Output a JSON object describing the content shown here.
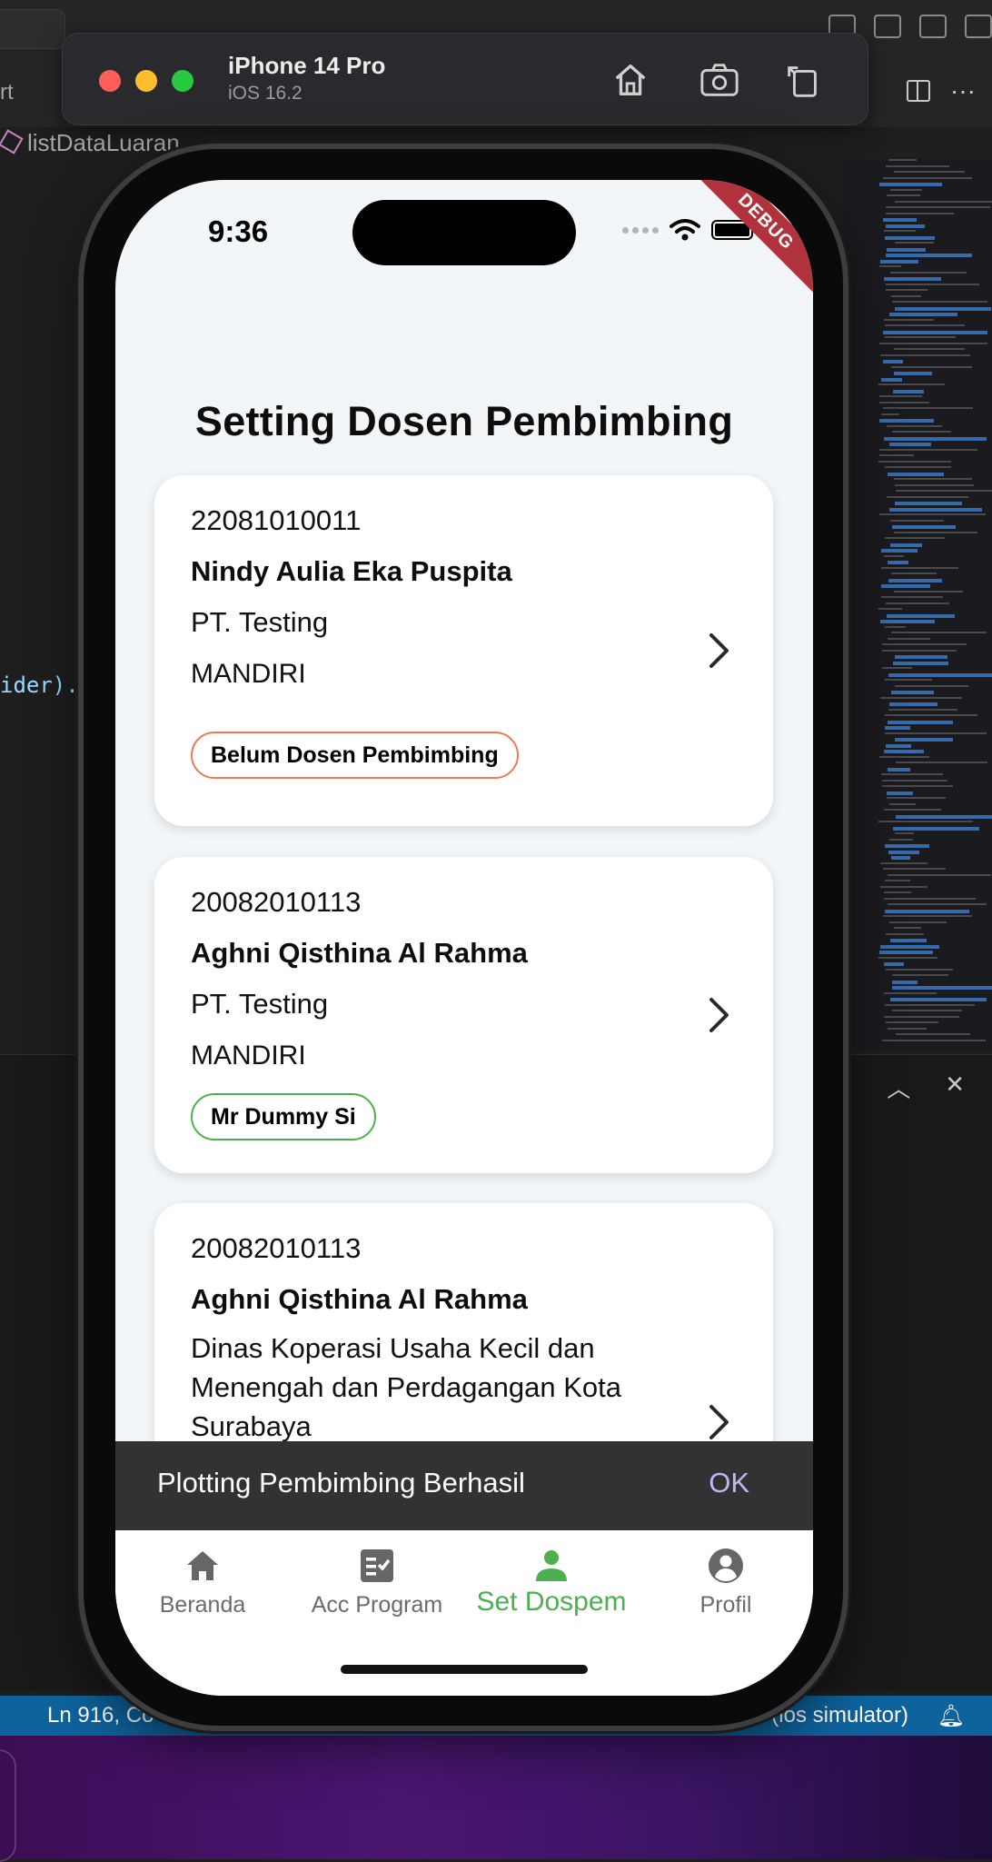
{
  "ide": {
    "tab_fragment": "rt",
    "breadcrumb": "listDataLuaran",
    "code_fragment": "ider).",
    "status_line": "Ln 916, Co",
    "status_target": "(ios simulator)"
  },
  "simulator": {
    "device_name": "iPhone 14 Pro",
    "os_version": "iOS 16.2"
  },
  "phone": {
    "time": "9:36",
    "debug_label": "DEBUG"
  },
  "page": {
    "title": "Setting Dosen Pembimbing"
  },
  "cards": [
    {
      "id": "22081010011",
      "name": "Nindy Aulia Eka Puspita",
      "company": "PT. Testing",
      "program": "MANDIRI",
      "chip": "Belum Dosen Pembimbing",
      "chip_color": "#ee7a55"
    },
    {
      "id": "20082010113",
      "name": "Aghni Qisthina Al Rahma",
      "company": "PT. Testing",
      "program": "MANDIRI",
      "chip": "Mr Dummy Si",
      "chip_color": "#4caf50"
    },
    {
      "id": "20082010113",
      "name": "Aghni Qisthina Al Rahma",
      "company": "Dinas Koperasi Usaha Kecil dan Menengah dan Perdagangan Kota Surabaya"
    }
  ],
  "snackbar": {
    "message": "Plotting Pembimbing Berhasil",
    "action": "OK"
  },
  "bottom_nav": {
    "items": [
      {
        "label": "Beranda",
        "icon": "home-icon",
        "active": false
      },
      {
        "label": "Acc Program",
        "icon": "checklist-icon",
        "active": false
      },
      {
        "label": "Set Dospem",
        "icon": "person-icon",
        "active": true
      },
      {
        "label": "Profil",
        "icon": "account-circle-icon",
        "active": false
      }
    ]
  },
  "colors": {
    "accent_green": "#4caf50",
    "warning_orange": "#ee7a55",
    "snackbar_bg": "#323232",
    "snackbar_action": "#c7b2f6",
    "screen_bg": "#f2f6f8"
  }
}
